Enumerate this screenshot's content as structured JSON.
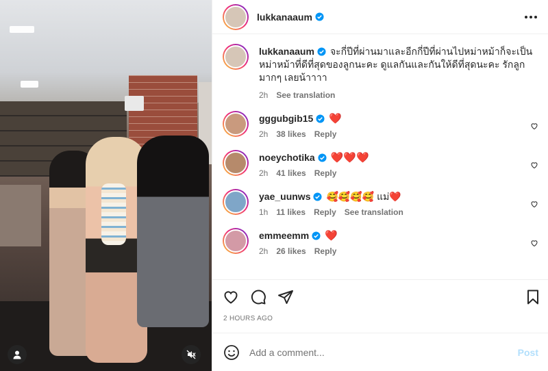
{
  "header": {
    "username": "lukkanaaum",
    "more_icon": "more-horizontal-icon"
  },
  "caption": {
    "username": "lukkanaaum",
    "text": "จะกี่ปีที่ผ่านมาและอีกกี่ปีที่ผ่านไปหม่าหม้าก็จะเป็นหม่าหม้าที่ดีที่สุดของลูกนะคะ ดูแลกันและกันให้ดีที่สุดนะคะ รักลูกมากๆ เลยน้าาาา",
    "time": "2h",
    "see_translation": "See translation"
  },
  "comments": [
    {
      "username": "gggubgib15",
      "text": "❤️",
      "time": "2h",
      "likes": "38 likes",
      "reply": "Reply",
      "avatar_color": "#c99a7e"
    },
    {
      "username": "noeychotika",
      "text": "❤️❤️❤️",
      "time": "2h",
      "likes": "41 likes",
      "reply": "Reply",
      "avatar_color": "#b68a6b"
    },
    {
      "username": "yae_uunws",
      "text": "🥰🥰🥰🥰 แม่❤️",
      "time": "1h",
      "likes": "11 likes",
      "reply": "Reply",
      "see_translation": "See translation",
      "avatar_color": "#7fa6c8"
    },
    {
      "username": "emmeemm",
      "text": "❤️",
      "time": "2h",
      "likes": "26 likes",
      "reply": "Reply",
      "avatar_color": "#d39aa6"
    }
  ],
  "timestamp": "2 HOURS AGO",
  "add_comment": {
    "placeholder": "Add a comment...",
    "post_label": "Post"
  },
  "colors": {
    "verified": "#0095f6",
    "heart": "#ed1b2e",
    "post_disabled": "#b2dffc"
  },
  "icons": {
    "actions": [
      "heart-icon",
      "comment-icon",
      "share-icon",
      "bookmark-icon"
    ],
    "photo": [
      "user-tag-icon",
      "audio-muted-icon"
    ],
    "composer": "emoji-icon"
  }
}
